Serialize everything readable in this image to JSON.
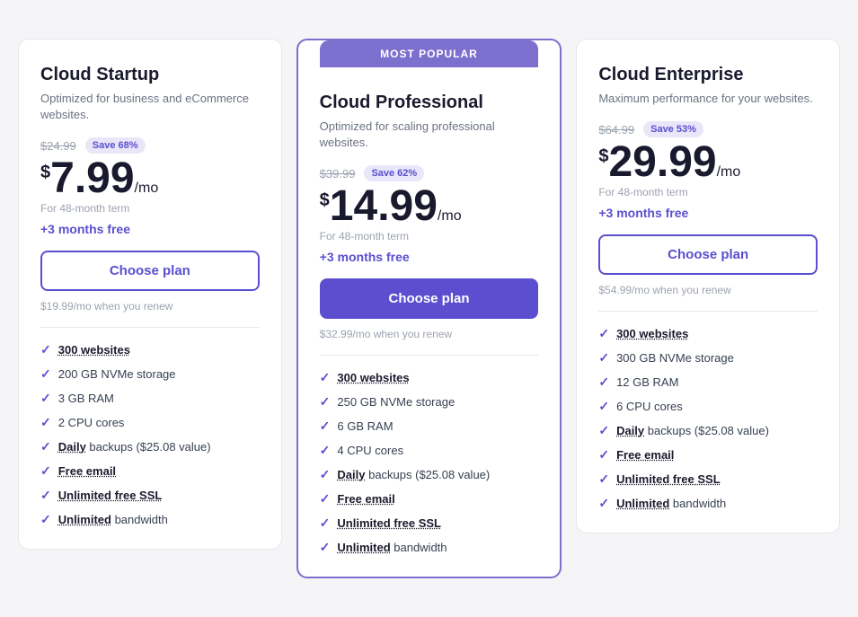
{
  "plans": [
    {
      "id": "startup",
      "popular": false,
      "name": "Cloud Startup",
      "description": "Optimized for business and eCommerce websites.",
      "originalPrice": "$24.99",
      "saveBadge": "Save 68%",
      "priceAmount": "7.99",
      "priceTerm": "For 48-month term",
      "monthsFree": "+3 months free",
      "btnLabel": "Choose plan",
      "btnStyle": "outline",
      "renewPrice": "$19.99/mo when you renew",
      "features": [
        {
          "linked": "300 websites",
          "rest": ""
        },
        {
          "linked": "",
          "rest": "200 GB NVMe storage"
        },
        {
          "linked": "",
          "rest": "3 GB RAM"
        },
        {
          "linked": "",
          "rest": "2 CPU cores"
        },
        {
          "linked": "Daily",
          "rest": " backups ($25.08 value)"
        },
        {
          "linked": "Free email",
          "rest": ""
        },
        {
          "linked": "Unlimited free SSL",
          "rest": ""
        },
        {
          "linked": "Unlimited",
          "rest": " bandwidth"
        }
      ]
    },
    {
      "id": "professional",
      "popular": true,
      "popularLabel": "MOST POPULAR",
      "name": "Cloud Professional",
      "description": "Optimized for scaling professional websites.",
      "originalPrice": "$39.99",
      "saveBadge": "Save 62%",
      "priceAmount": "14.99",
      "priceTerm": "For 48-month term",
      "monthsFree": "+3 months free",
      "btnLabel": "Choose plan",
      "btnStyle": "filled",
      "renewPrice": "$32.99/mo when you renew",
      "features": [
        {
          "linked": "300 websites",
          "rest": ""
        },
        {
          "linked": "",
          "rest": "250 GB NVMe storage"
        },
        {
          "linked": "",
          "rest": "6 GB RAM"
        },
        {
          "linked": "",
          "rest": "4 CPU cores"
        },
        {
          "linked": "Daily",
          "rest": " backups ($25.08 value)"
        },
        {
          "linked": "Free email",
          "rest": ""
        },
        {
          "linked": "Unlimited free SSL",
          "rest": ""
        },
        {
          "linked": "Unlimited",
          "rest": " bandwidth"
        }
      ]
    },
    {
      "id": "enterprise",
      "popular": false,
      "name": "Cloud Enterprise",
      "description": "Maximum performance for your websites.",
      "originalPrice": "$64.99",
      "saveBadge": "Save 53%",
      "priceAmount": "29.99",
      "priceTerm": "For 48-month term",
      "monthsFree": "+3 months free",
      "btnLabel": "Choose plan",
      "btnStyle": "outline",
      "renewPrice": "$54.99/mo when you renew",
      "features": [
        {
          "linked": "300 websites",
          "rest": ""
        },
        {
          "linked": "",
          "rest": "300 GB NVMe storage"
        },
        {
          "linked": "",
          "rest": "12 GB RAM"
        },
        {
          "linked": "",
          "rest": "6 CPU cores"
        },
        {
          "linked": "Daily",
          "rest": " backups ($25.08 value)"
        },
        {
          "linked": "Free email",
          "rest": ""
        },
        {
          "linked": "Unlimited free SSL",
          "rest": ""
        },
        {
          "linked": "Unlimited",
          "rest": " bandwidth"
        }
      ]
    }
  ]
}
